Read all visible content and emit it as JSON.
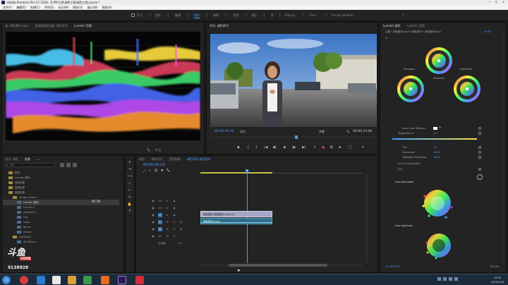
{
  "window": {
    "title": "Adobe Premiere Pro CC 2018 - E:\\PR工程\\调色工程\\调色工程.prproj *",
    "minimize": "—",
    "maximize": "□",
    "close": "✕"
  },
  "menu": [
    "文件(F)",
    "编辑(E)",
    "剪辑(C)",
    "序列(S)",
    "标记(M)",
    "图形(G)",
    "窗口(W)",
    "帮助(H)"
  ],
  "workspaces": {
    "tabs": [
      "学习",
      "组件",
      "编辑",
      "颜色",
      "效果",
      "音频",
      "图形",
      "库",
      "Editing",
      "Color"
    ],
    "active": "颜色",
    "extra": "Project window"
  },
  "source_panel": {
    "tabs": [
      "源: 调色素材.mp4",
      "音频剪辑混合器: 调色序列",
      "Lumetri 范围"
    ],
    "active": 2
  },
  "program_panel": {
    "title": "节目: 调色序列",
    "timecode_left": "00:00:00:19",
    "fit": "适合",
    "quality": "完整",
    "timecode_right": "00:00:15:04",
    "controls": [
      "◆",
      "{",
      "}",
      "|◀",
      "◀|",
      "▶",
      "|▶",
      "▶|",
      "⧉",
      "⇪",
      "📷",
      "⧈",
      "+"
    ]
  },
  "lumetri_panel": {
    "tabs": [
      "Lumetri 颜色",
      "Lumetri 范围"
    ],
    "header": "主要 * 调色素材.mp4 ▾ 调色序列 * 调色素材.mp4",
    "fx_label": "fx",
    "wheels_title": "",
    "wheel_midtones": "Midtones",
    "wheel_shadows": "Shadows",
    "wheel_highlights": "Highlights",
    "auto_color": "Auto Color Balance",
    "temperature": "Temperature",
    "temperature_val": "0.0",
    "rows": [
      {
        "label": "Tint",
        "val": "0.0"
      },
      {
        "label": "Saturation",
        "val": "100.0"
      },
      {
        "label": "Highlight Saturation",
        "val": "100.0"
      }
    ],
    "hue_vs_sat": "Hue vs Saturation",
    "hsl": "HSL",
    "hue_saturation_title": "Hue Saturation",
    "hue_lightness_title": "Hue Lightness",
    "bottom_tc": "00:00:00:19",
    "bottom_right": "100.0%",
    "top_right_tc": "00:00"
  },
  "project_panel": {
    "tabs": [
      "项目: 调色",
      "效果",
      "≡"
    ],
    "search": "All",
    "items": [
      {
        "type": "folder",
        "label": "预设",
        "indent": 1
      },
      {
        "type": "folder",
        "label": "Lumetri 预设",
        "indent": 1
      },
      {
        "type": "folder",
        "label": "音频效果",
        "indent": 1
      },
      {
        "type": "folder",
        "label": "音频过渡",
        "indent": 1
      },
      {
        "type": "folder",
        "label": "视频效果",
        "indent": 1
      },
      {
        "type": "folder",
        "label": "Image Control",
        "indent": 2
      },
      {
        "type": "clip",
        "label": "Lumetri 颜色",
        "indent": 3,
        "selected": true
      },
      {
        "type": "clip",
        "label": "Lumetri 2",
        "indent": 3
      },
      {
        "type": "clip",
        "label": "Obsolete 3",
        "indent": 3
      },
      {
        "type": "clip",
        "label": "Dev",
        "indent": 3
      },
      {
        "type": "clip",
        "label": "Layer",
        "indent": 3
      },
      {
        "type": "clip",
        "label": "Blend",
        "indent": 3
      },
      {
        "type": "clip",
        "label": "Distort",
        "indent": 3
      },
      {
        "type": "folder",
        "label": "Transition",
        "indent": 2
      },
      {
        "type": "clip",
        "label": "3D Motion",
        "indent": 3
      }
    ],
    "watermark_logo": "斗鱼",
    "watermark_sub": "斗鱼直播",
    "watermark_id": "9138828"
  },
  "timeline": {
    "tabs": [
      "调色",
      "调色序列",
      "音频剪辑",
      "调色序列 调色素材"
    ],
    "active": 3,
    "timecode": "00:00:00:19",
    "tracks": [
      "V3",
      "V2",
      "V1",
      "A1",
      "A2",
      "A3"
    ],
    "clip_v": "调色素材 调色素材.mp4 [V]",
    "clip_a": "调色素材.mp4",
    "master": "主声道",
    "master_val": "0.0"
  },
  "taskbar": {
    "time": "19:03",
    "date": "2020/2/16"
  },
  "colors": {
    "accent": "#4c9cff",
    "panel": "#232323",
    "bg": "#1b1b1b"
  }
}
